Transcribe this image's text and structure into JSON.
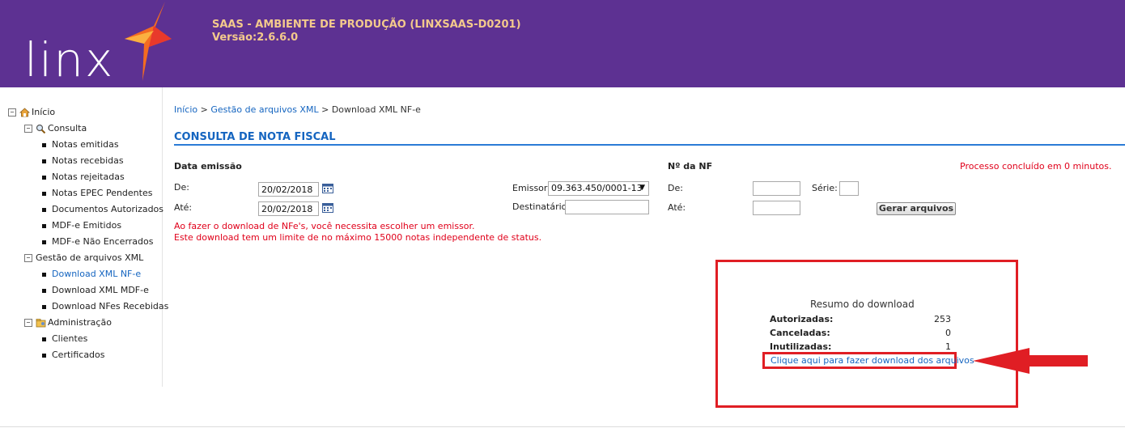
{
  "header": {
    "logo_text": "linx",
    "title": "SAAS - AMBIENTE DE PRODUÇÃO (LINXSAAS-D0201)",
    "version": "Versão:2.6.6.0"
  },
  "sidebar": {
    "root": {
      "label": "Início",
      "toggle": "−"
    },
    "consulta": {
      "label": "Consulta",
      "toggle": "−"
    },
    "consulta_items": [
      "Notas emitidas",
      "Notas recebidas",
      "Notas rejeitadas",
      "Notas EPEC Pendentes",
      "Documentos Autorizados",
      "MDF-e Emitidos",
      "MDF-e Não Encerrados"
    ],
    "gestao": {
      "label": "Gestão de arquivos XML",
      "toggle": "−"
    },
    "gestao_items": [
      "Download XML NF-e",
      "Download XML MDF-e",
      "Download NFes Recebidas"
    ],
    "admin": {
      "label": "Administração",
      "toggle": "−"
    },
    "admin_items": [
      "Clientes",
      "Certificados"
    ]
  },
  "breadcrumb": {
    "home": "Início",
    "sep1": " > ",
    "section": "Gestão de arquivos XML",
    "sep2": " > ",
    "current": "Download XML NF-e"
  },
  "form": {
    "title": "CONSULTA DE NOTA FISCAL",
    "data_emissao_label": "Data emissão",
    "de_label": "De:",
    "de_value": "20/02/2018",
    "ate_label": "Até:",
    "ate_value": "20/02/2018",
    "emissor_label": "Emissor:",
    "emissor_value": "09.363.450/0001-13",
    "destinatario_label": "Destinatário:",
    "destinatario_value": "",
    "nf_label": "Nº da NF",
    "nf_de_label": "De:",
    "nf_ate_label": "Até:",
    "serie_label": "Série:",
    "gerar_button": "Gerar arquivos",
    "status_message": "Processo concluído em 0 minutos.",
    "warning_1": "Ao fazer o download de NFe's, você necessita escolher um emissor.",
    "warning_2": "Este download tem um limite de no máximo 15000 notas independente de status."
  },
  "summary": {
    "title": "Resumo do download",
    "autorizadas_label": "Autorizadas:",
    "autorizadas_value": "253",
    "canceladas_label": "Canceladas:",
    "canceladas_value": "0",
    "inutilizadas_label": "Inutilizadas:",
    "inutilizadas_value": "1",
    "download_link": "Clique aqui para fazer download dos arquivos"
  },
  "colors": {
    "header_bg": "#5d3192",
    "header_text": "#f3c98c",
    "link": "#1565c0",
    "warning": "#e0001a",
    "highlight": "#e01e24"
  }
}
